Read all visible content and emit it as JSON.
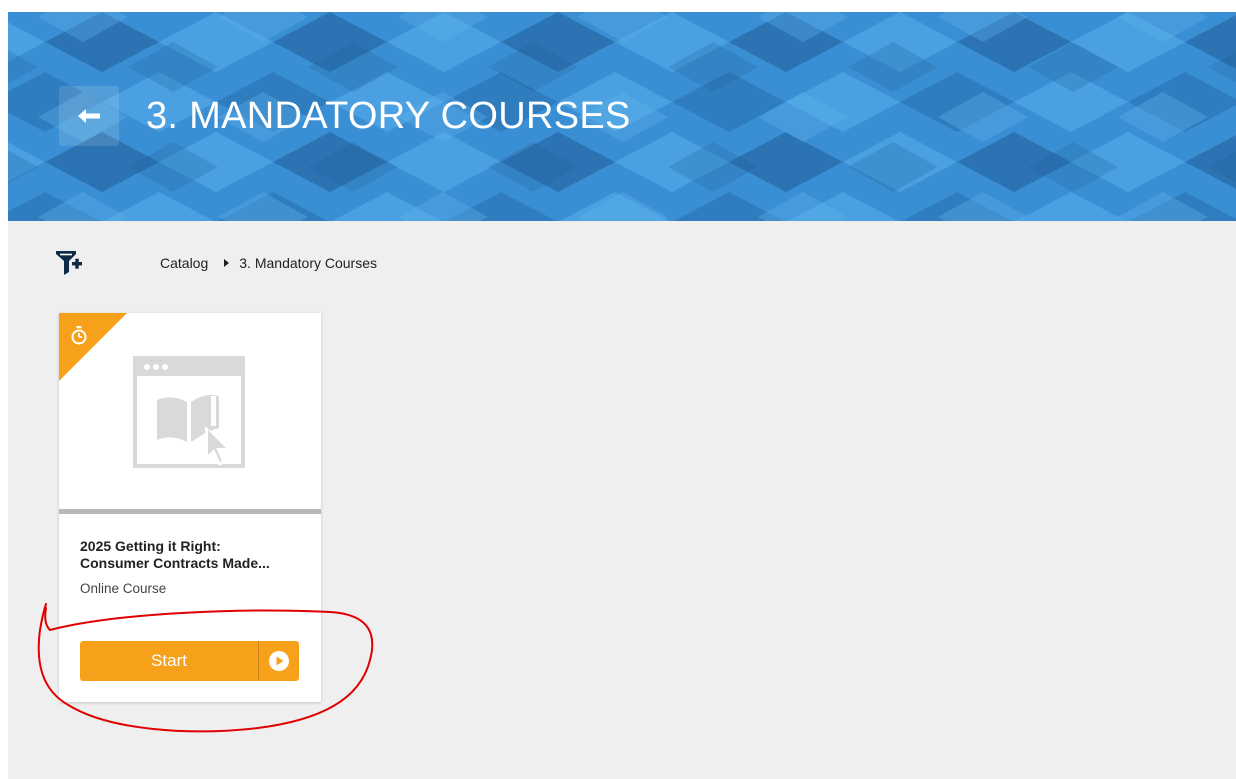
{
  "header": {
    "title": "3. MANDATORY COURSES",
    "back_icon": "back-arrow-icon"
  },
  "toolbar": {
    "filter_icon": "filter-add-icon"
  },
  "breadcrumb": {
    "items": [
      "Catalog",
      "3. Mandatory Courses"
    ],
    "separator_icon": "caret-right-icon"
  },
  "course_card": {
    "title_line1": "2025 Getting it Right:",
    "title_line2": "Consumer Contracts Made...",
    "type": "Online Course",
    "badge_icon": "timer-icon",
    "thumbnail_icon": "online-course-placeholder-icon",
    "start_label": "Start",
    "start_icon": "play-circle-icon"
  },
  "colors": {
    "hero_blue": "#3a8fd4",
    "accent_orange": "#f7a11a",
    "background": "#efefef",
    "annotation_red": "#e00000"
  }
}
